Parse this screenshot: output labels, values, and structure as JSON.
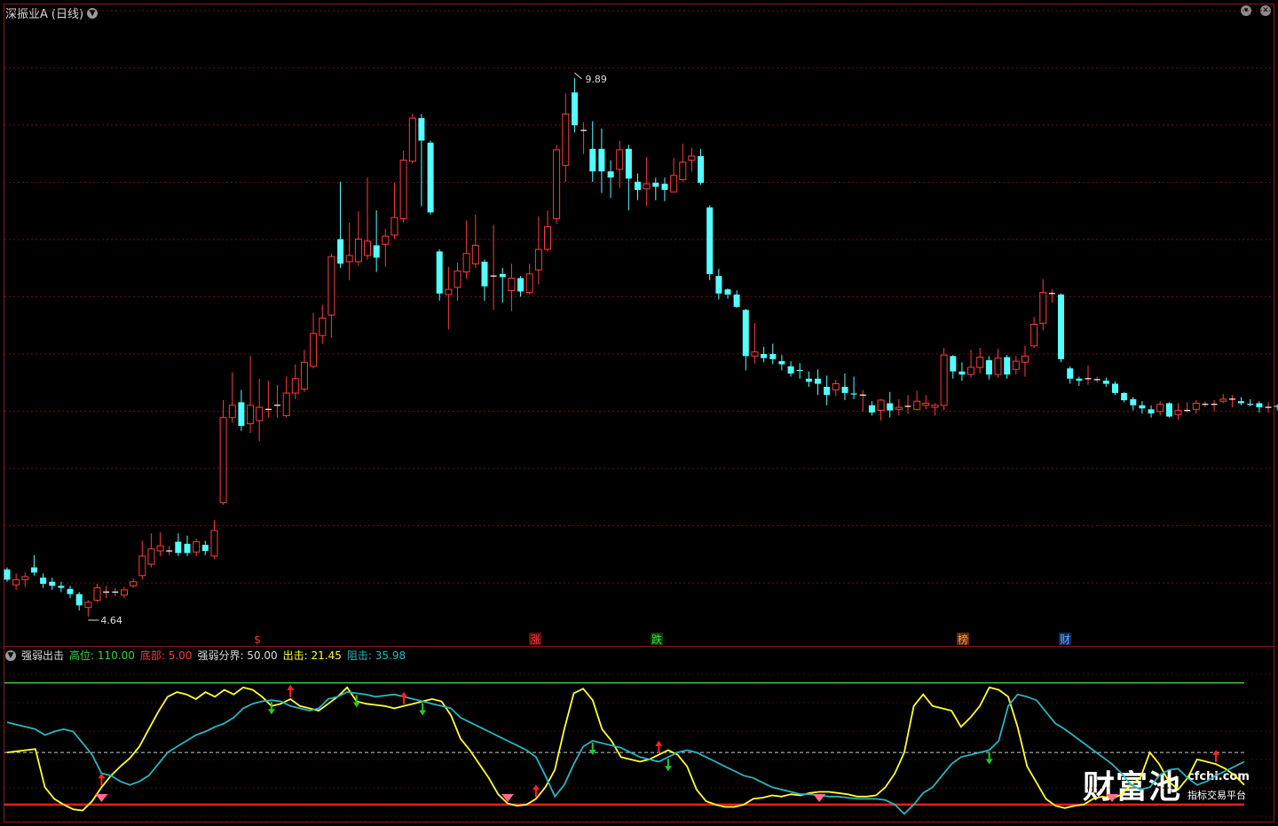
{
  "window": {
    "title": "深振业A",
    "period": "(日线)"
  },
  "colors": {
    "up": "#ff3b3b",
    "down": "#54ffff",
    "grid": "#7a1010",
    "bg": "#000000"
  },
  "main_chart": {
    "annot_high": "9.89",
    "annot_low": "4.64",
    "event_markers": [
      "$",
      "涨",
      "跌",
      "榜",
      "财"
    ]
  },
  "indicator": {
    "name": "强弱出击",
    "params": [
      {
        "label": "高位:",
        "value": "110.00",
        "color": "#3fcf3f"
      },
      {
        "label": "底部:",
        "value": "5.00",
        "color": "#ff3b3b"
      },
      {
        "label": "强弱分界:",
        "value": "50.00",
        "color": "#dddddd"
      },
      {
        "label": "出击:",
        "value": "21.45",
        "color": "#ffff33"
      },
      {
        "label": "阻击:",
        "value": "35.98",
        "color": "#2bb5c0"
      }
    ]
  },
  "chart_data": [
    {
      "type": "candlestick",
      "high_label": "9.89",
      "low_label": "4.64",
      "candles": [
        [
          5.1,
          5.0,
          5.12,
          4.98
        ],
        [
          4.95,
          5.0,
          5.06,
          4.9
        ],
        [
          5.0,
          5.03,
          5.07,
          4.93
        ],
        [
          5.12,
          5.07,
          5.24,
          5.04
        ],
        [
          5.02,
          4.96,
          5.06,
          4.92
        ],
        [
          4.98,
          4.94,
          5.02,
          4.9
        ],
        [
          4.94,
          4.92,
          4.98,
          4.88
        ],
        [
          4.91,
          4.86,
          4.94,
          4.82
        ],
        [
          4.86,
          4.75,
          4.88,
          4.7
        ],
        [
          4.73,
          4.78,
          4.8,
          4.64
        ],
        [
          4.8,
          4.92,
          4.96,
          4.78
        ],
        [
          4.88,
          4.88,
          4.94,
          4.82
        ],
        [
          4.88,
          4.88,
          4.92,
          4.84
        ],
        [
          4.85,
          4.9,
          4.93,
          4.82
        ],
        [
          4.94,
          4.98,
          5.01,
          4.92
        ],
        [
          5.04,
          5.23,
          5.38,
          5.0
        ],
        [
          5.15,
          5.3,
          5.45,
          5.12
        ],
        [
          5.28,
          5.33,
          5.46,
          5.23
        ],
        [
          5.28,
          5.28,
          5.33,
          5.24
        ],
        [
          5.37,
          5.26,
          5.45,
          5.23
        ],
        [
          5.35,
          5.26,
          5.43,
          5.23
        ],
        [
          5.27,
          5.37,
          5.4,
          5.23
        ],
        [
          5.34,
          5.28,
          5.38,
          5.24
        ],
        [
          5.23,
          5.48,
          5.58,
          5.2
        ],
        [
          5.75,
          6.58,
          6.75,
          5.73
        ],
        [
          6.58,
          6.7,
          7.02,
          6.53
        ],
        [
          6.73,
          6.5,
          6.85,
          6.45
        ],
        [
          6.52,
          6.7,
          7.18,
          6.43
        ],
        [
          6.55,
          6.68,
          6.96,
          6.35
        ],
        [
          6.65,
          6.66,
          6.94,
          6.58
        ],
        [
          6.7,
          6.7,
          6.9,
          6.58
        ],
        [
          6.6,
          6.82,
          6.98,
          6.58
        ],
        [
          6.82,
          6.96,
          7.1,
          6.76
        ],
        [
          6.86,
          7.12,
          7.24,
          6.83
        ],
        [
          7.08,
          7.4,
          7.6,
          7.06
        ],
        [
          7.38,
          7.55,
          7.68,
          7.3
        ],
        [
          7.58,
          8.15,
          8.18,
          7.36
        ],
        [
          8.32,
          8.08,
          8.88,
          8.04
        ],
        [
          8.1,
          8.16,
          8.48,
          7.92
        ],
        [
          8.1,
          8.32,
          8.59,
          8.06
        ],
        [
          8.16,
          8.3,
          8.92,
          8.12
        ],
        [
          8.26,
          8.14,
          8.6,
          8.0
        ],
        [
          8.27,
          8.35,
          8.42,
          8.05
        ],
        [
          8.36,
          8.53,
          8.87,
          8.32
        ],
        [
          8.52,
          9.09,
          9.18,
          8.48
        ],
        [
          9.08,
          9.5,
          9.54,
          9.06
        ],
        [
          9.5,
          9.28,
          9.54,
          8.64
        ],
        [
          9.26,
          8.58,
          9.28,
          8.56
        ],
        [
          8.2,
          7.79,
          8.22,
          7.72
        ],
        [
          7.78,
          7.83,
          8.05,
          7.44
        ],
        [
          7.85,
          8.01,
          8.09,
          7.72
        ],
        [
          8.0,
          8.18,
          8.5,
          7.93
        ],
        [
          8.08,
          8.26,
          8.56,
          8.04
        ],
        [
          8.1,
          7.86,
          8.12,
          7.72
        ],
        [
          7.96,
          7.96,
          8.46,
          7.63
        ],
        [
          7.98,
          7.95,
          8.04,
          7.7
        ],
        [
          7.82,
          7.94,
          8.08,
          7.62
        ],
        [
          7.94,
          7.81,
          7.96,
          7.76
        ],
        [
          7.8,
          7.98,
          8.08,
          7.78
        ],
        [
          8.02,
          8.22,
          8.54,
          7.88
        ],
        [
          8.22,
          8.44,
          8.6,
          8.2
        ],
        [
          8.52,
          9.19,
          9.24,
          8.47
        ],
        [
          9.04,
          9.54,
          9.74,
          8.88
        ],
        [
          9.75,
          9.43,
          9.89,
          9.36
        ],
        [
          9.38,
          9.38,
          9.46,
          9.15
        ],
        [
          9.2,
          8.98,
          9.47,
          8.88
        ],
        [
          9.2,
          8.98,
          9.4,
          8.77
        ],
        [
          8.98,
          8.92,
          9.09,
          8.72
        ],
        [
          9.0,
          9.19,
          9.28,
          8.82
        ],
        [
          9.2,
          8.91,
          9.24,
          8.6
        ],
        [
          8.88,
          8.8,
          8.96,
          8.7
        ],
        [
          8.81,
          8.86,
          9.12,
          8.64
        ],
        [
          8.87,
          8.83,
          8.92,
          8.7
        ],
        [
          8.86,
          8.8,
          8.92,
          8.69
        ],
        [
          8.78,
          8.94,
          9.11,
          8.8
        ],
        [
          8.9,
          9.07,
          9.25,
          8.88
        ],
        [
          9.09,
          9.13,
          9.21,
          8.98
        ],
        [
          9.13,
          8.87,
          9.2,
          8.85
        ],
        [
          8.63,
          7.98,
          8.65,
          7.92
        ],
        [
          7.96,
          7.79,
          8.03,
          7.73
        ],
        [
          7.83,
          7.78,
          7.84,
          7.74
        ],
        [
          7.78,
          7.66,
          7.82,
          7.65
        ],
        [
          7.63,
          7.18,
          7.64,
          7.04
        ],
        [
          7.18,
          7.22,
          7.5,
          7.11
        ],
        [
          7.2,
          7.16,
          7.27,
          7.12
        ],
        [
          7.2,
          7.15,
          7.3,
          7.1
        ],
        [
          7.13,
          7.1,
          7.19,
          7.04
        ],
        [
          7.08,
          7.01,
          7.13,
          6.98
        ],
        [
          7.04,
          7.03,
          7.11,
          6.96
        ],
        [
          6.96,
          6.93,
          7.03,
          6.88
        ],
        [
          6.96,
          6.91,
          7.05,
          6.8
        ],
        [
          6.88,
          6.8,
          6.99,
          6.7
        ],
        [
          6.85,
          6.91,
          6.95,
          6.79
        ],
        [
          6.88,
          6.82,
          7.01,
          6.75
        ],
        [
          6.81,
          6.8,
          6.98,
          6.76
        ],
        [
          6.8,
          6.8,
          6.85,
          6.64
        ],
        [
          6.7,
          6.63,
          6.74,
          6.6
        ],
        [
          6.65,
          6.75,
          6.76,
          6.55
        ],
        [
          6.72,
          6.65,
          6.83,
          6.58
        ],
        [
          6.66,
          6.68,
          6.76,
          6.6
        ],
        [
          6.68,
          6.69,
          6.8,
          6.62
        ],
        [
          6.66,
          6.74,
          6.84,
          6.65
        ],
        [
          6.7,
          6.72,
          6.8,
          6.66
        ],
        [
          6.68,
          6.7,
          6.72,
          6.6
        ],
        [
          6.7,
          7.19,
          7.26,
          6.65
        ],
        [
          7.18,
          7.03,
          7.19,
          6.96
        ],
        [
          7.03,
          7.0,
          7.12,
          6.94
        ],
        [
          7.0,
          7.07,
          7.24,
          6.97
        ],
        [
          7.07,
          7.17,
          7.26,
          7.01
        ],
        [
          7.14,
          7.0,
          7.18,
          6.95
        ],
        [
          7.0,
          7.16,
          7.25,
          6.97
        ],
        [
          7.17,
          7.0,
          7.19,
          6.96
        ],
        [
          7.05,
          7.13,
          7.18,
          7.0
        ],
        [
          7.12,
          7.18,
          7.28,
          6.98
        ],
        [
          7.28,
          7.49,
          7.56,
          7.26
        ],
        [
          7.5,
          7.8,
          7.93,
          7.43
        ],
        [
          7.78,
          7.79,
          7.83,
          7.7
        ],
        [
          7.78,
          7.15,
          7.79,
          7.12
        ],
        [
          7.06,
          6.96,
          7.08,
          6.91
        ],
        [
          6.96,
          6.94,
          6.98,
          6.89
        ],
        [
          6.96,
          6.96,
          7.09,
          6.9
        ],
        [
          6.95,
          6.95,
          6.98,
          6.92
        ],
        [
          6.94,
          6.91,
          6.97,
          6.88
        ],
        [
          6.91,
          6.82,
          6.93,
          6.8
        ],
        [
          6.82,
          6.75,
          6.83,
          6.73
        ],
        [
          6.76,
          6.7,
          6.78,
          6.65
        ],
        [
          6.7,
          6.67,
          6.74,
          6.62
        ],
        [
          6.66,
          6.62,
          6.7,
          6.58
        ],
        [
          6.64,
          6.71,
          6.74,
          6.6
        ],
        [
          6.72,
          6.59,
          6.73,
          6.58
        ],
        [
          6.61,
          6.65,
          6.72,
          6.56
        ],
        [
          6.65,
          6.65,
          6.73,
          6.63
        ],
        [
          6.66,
          6.72,
          6.75,
          6.62
        ],
        [
          6.71,
          6.71,
          6.74,
          6.68
        ],
        [
          6.7,
          6.71,
          6.75,
          6.64
        ],
        [
          6.74,
          6.76,
          6.81,
          6.72
        ],
        [
          6.76,
          6.76,
          6.8,
          6.68
        ],
        [
          6.74,
          6.72,
          6.78,
          6.7
        ],
        [
          6.71,
          6.7,
          6.76,
          6.69
        ],
        [
          6.72,
          6.68,
          6.74,
          6.63
        ],
        [
          6.67,
          6.68,
          6.73,
          6.63
        ],
        [
          6.69,
          6.68,
          6.71,
          6.65
        ],
        [
          6.67,
          6.65,
          6.69,
          6.62
        ],
        [
          6.65,
          6.66,
          6.68,
          6.61
        ]
      ]
    },
    {
      "type": "line",
      "name": "强弱出击",
      "ylim": [
        -5,
        125
      ],
      "reference_lines": [
        {
          "name": "高位",
          "value": 110,
          "color": "#3fcf3f"
        },
        {
          "name": "强弱分界",
          "value": 50,
          "color": "#cccccc"
        },
        {
          "name": "底部",
          "value": 5,
          "color": "#ff1a1a"
        }
      ],
      "series": [
        {
          "name": "出击",
          "color": "#ffff33",
          "values": [
            50,
            51,
            52,
            53,
            20,
            10,
            5,
            1,
            0,
            8,
            20,
            30,
            38,
            45,
            55,
            70,
            85,
            98,
            102,
            100,
            96,
            102,
            98,
            104,
            100,
            106,
            104,
            98,
            90,
            92,
            96,
            90,
            88,
            86,
            92,
            98,
            106,
            94,
            92,
            91,
            90,
            88,
            90,
            92,
            94,
            96,
            94,
            82,
            62,
            52,
            40,
            28,
            14,
            6,
            4,
            5,
            10,
            20,
            35,
            70,
            101,
            105,
            95,
            70,
            60,
            46,
            44,
            42,
            44,
            48,
            52,
            48,
            38,
            18,
            8,
            5,
            3,
            3,
            5,
            10,
            11,
            13,
            12,
            14,
            13,
            15,
            16,
            16,
            15,
            14,
            12,
            12,
            13,
            20,
            32,
            50,
            90,
            100,
            90,
            88,
            86,
            72,
            80,
            90,
            106,
            104,
            98,
            72,
            38,
            24,
            10,
            4,
            2,
            4,
            5,
            10,
            12,
            10,
            14,
            22,
            28,
            50,
            40,
            25,
            18,
            28,
            44,
            42,
            40,
            36,
            30,
            22
          ]
        },
        {
          "name": "阻击",
          "color": "#2bb5c0",
          "values": [
            76,
            74,
            72,
            70,
            65,
            68,
            70,
            68,
            58,
            48,
            32,
            30,
            25,
            22,
            25,
            30,
            40,
            50,
            55,
            60,
            65,
            68,
            72,
            75,
            80,
            88,
            92,
            94,
            95,
            94,
            90,
            88,
            86,
            88,
            96,
            98,
            102,
            101,
            100,
            98,
            99,
            100,
            98,
            96,
            94,
            92,
            90,
            88,
            80,
            76,
            72,
            68,
            64,
            60,
            56,
            52,
            46,
            30,
            12,
            22,
            40,
            55,
            60,
            58,
            56,
            54,
            50,
            46,
            44,
            42,
            46,
            50,
            52,
            50,
            46,
            42,
            38,
            34,
            30,
            28,
            24,
            20,
            18,
            16,
            14,
            14,
            13,
            12,
            12,
            11,
            10,
            10,
            10,
            9,
            5,
            -3,
            5,
            15,
            20,
            30,
            40,
            46,
            48,
            50,
            52,
            60,
            90,
            100,
            98,
            95,
            85,
            75,
            70,
            64,
            58,
            52,
            46,
            40,
            32,
            22,
            18,
            20,
            30,
            35,
            36,
            28,
            22,
            25,
            30,
            34,
            38,
            42
          ]
        }
      ]
    }
  ]
}
